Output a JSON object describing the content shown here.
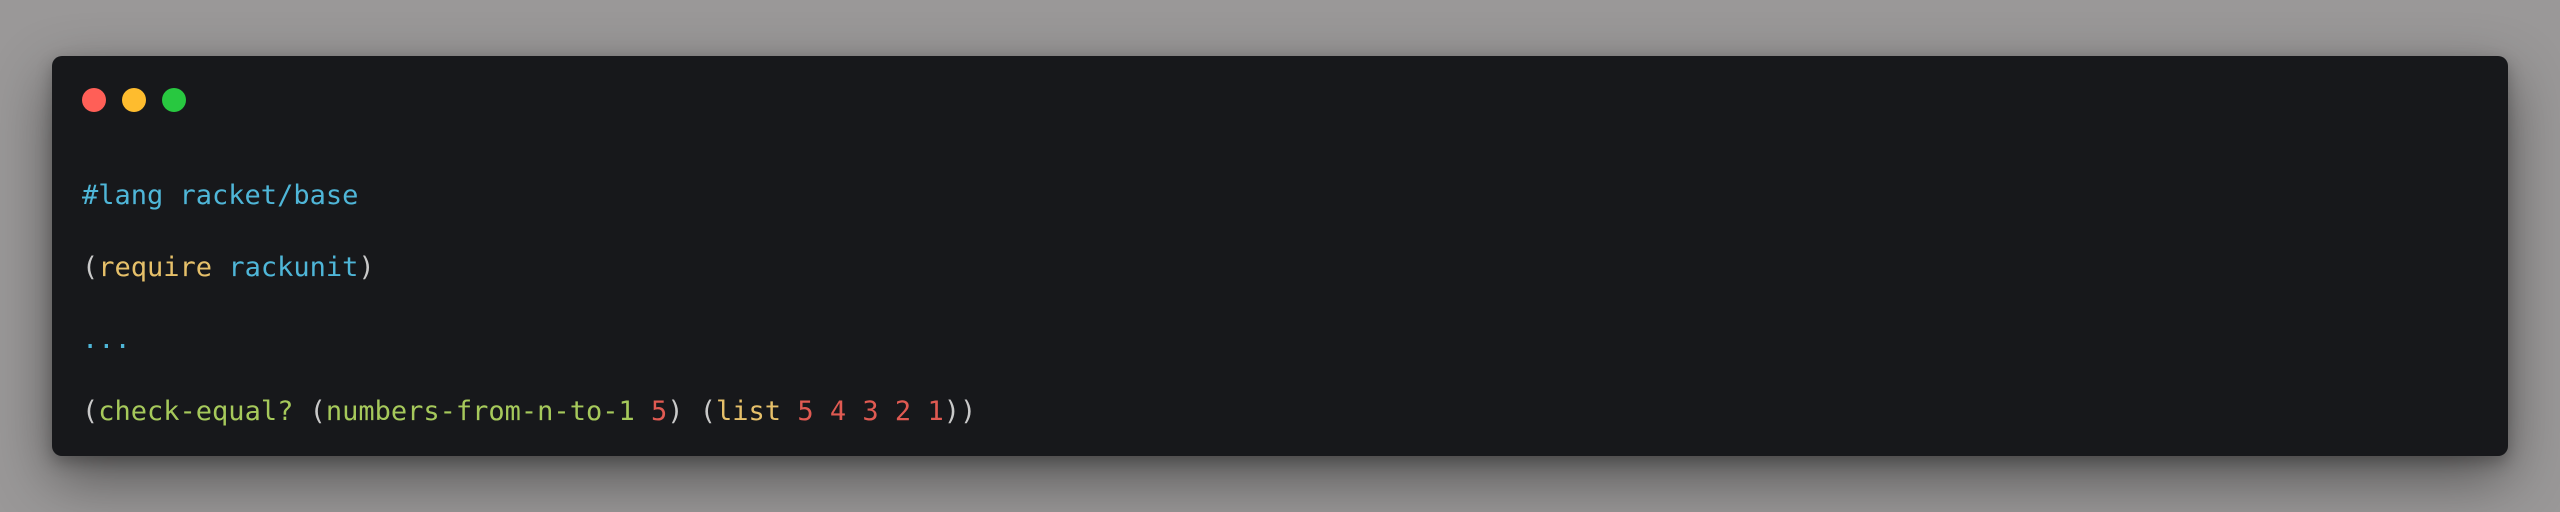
{
  "window": {
    "buttons": [
      {
        "name": "close",
        "color": "#ff5f57"
      },
      {
        "name": "minimize",
        "color": "#febc2e"
      },
      {
        "name": "zoom",
        "color": "#28c840"
      }
    ]
  },
  "colors": {
    "default": "#c9c9c9",
    "directive": "#4fb6d8",
    "keyword": "#e6c06a",
    "identifier": "#4fb6d8",
    "function": "#a6c95b",
    "number": "#e05a52",
    "ellipsis": "#4fb6d8"
  },
  "code": {
    "lines": [
      [
        {
          "text": "#lang racket/base",
          "kind": "directive"
        }
      ],
      [
        {
          "text": "(",
          "kind": "default"
        },
        {
          "text": "require",
          "kind": "keyword"
        },
        {
          "text": " ",
          "kind": "default"
        },
        {
          "text": "rackunit",
          "kind": "identifier"
        },
        {
          "text": ")",
          "kind": "default"
        }
      ],
      [
        {
          "text": "...",
          "kind": "ellipsis"
        }
      ],
      [
        {
          "text": "(",
          "kind": "default"
        },
        {
          "text": "check-equal?",
          "kind": "function"
        },
        {
          "text": " (",
          "kind": "default"
        },
        {
          "text": "numbers-from-n-to-1",
          "kind": "function"
        },
        {
          "text": " ",
          "kind": "default"
        },
        {
          "text": "5",
          "kind": "number"
        },
        {
          "text": ") (",
          "kind": "default"
        },
        {
          "text": "list",
          "kind": "keyword"
        },
        {
          "text": " ",
          "kind": "default"
        },
        {
          "text": "5",
          "kind": "number"
        },
        {
          "text": " ",
          "kind": "default"
        },
        {
          "text": "4",
          "kind": "number"
        },
        {
          "text": " ",
          "kind": "default"
        },
        {
          "text": "3",
          "kind": "number"
        },
        {
          "text": " ",
          "kind": "default"
        },
        {
          "text": "2",
          "kind": "number"
        },
        {
          "text": " ",
          "kind": "default"
        },
        {
          "text": "1",
          "kind": "number"
        },
        {
          "text": "))",
          "kind": "default"
        }
      ]
    ]
  }
}
